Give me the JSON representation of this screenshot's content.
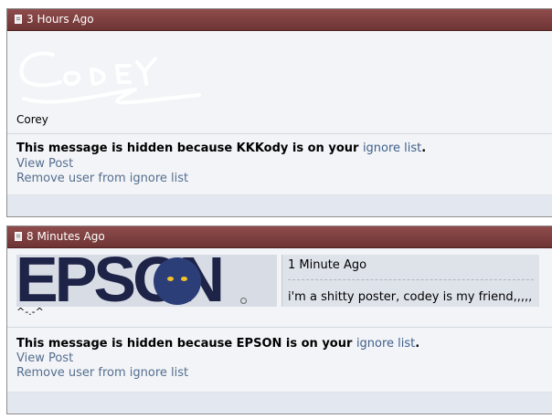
{
  "posts": [
    {
      "time": "3 Hours Ago",
      "signature_name": "Corey",
      "hidden_prefix": "This message is hidden because KKKody is on your ",
      "ignore_link": "ignore list",
      "hidden_suffix": ".",
      "view_post": "View Post",
      "remove_user": "Remove user from ignore list"
    },
    {
      "time": "8 Minutes Ago",
      "avatar_text": "EPSON",
      "avatar_caption": "^-.-^",
      "quote_time": "1 Minute Ago",
      "quote_text": "i'm a shitty poster, codey is my friend,,,,,",
      "hidden_prefix": "This message is hidden because EPSON is on your ",
      "ignore_link": "ignore list",
      "hidden_suffix": ".",
      "view_post": "View Post",
      "remove_user": "Remove user from ignore list"
    }
  ],
  "colors": {
    "header": "#7b3c3c",
    "link": "#556e8f",
    "post_bg": "#f2f4f7"
  }
}
